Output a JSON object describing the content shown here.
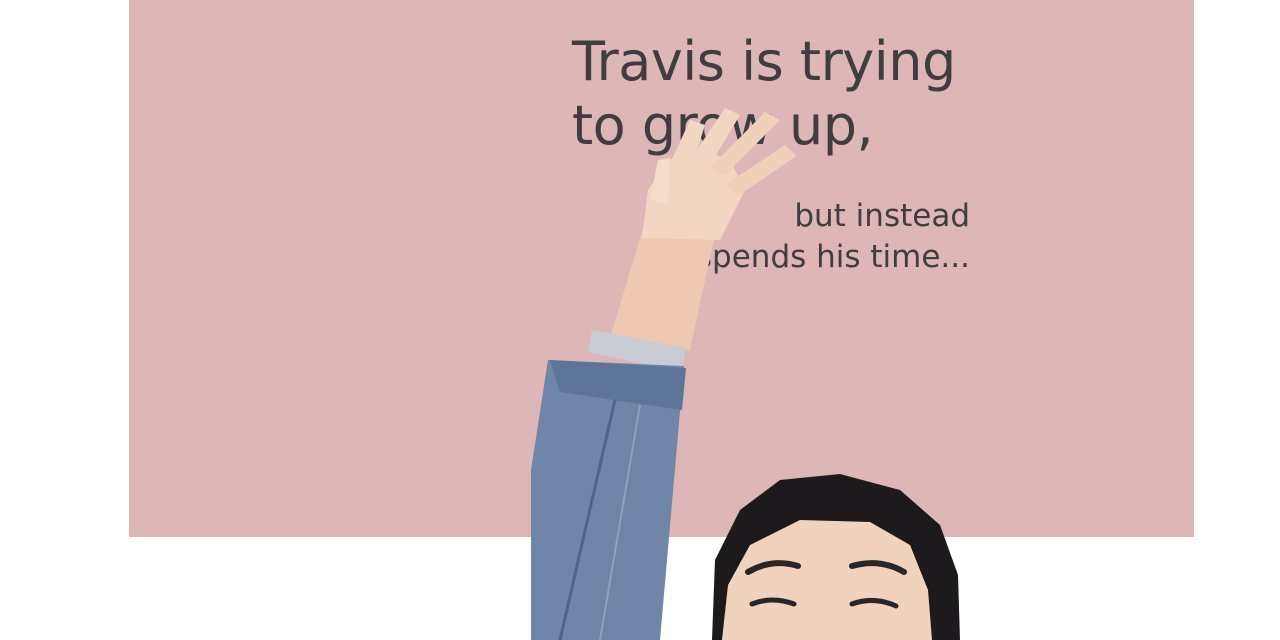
{
  "hero": {
    "headline_line1": "Travis is trying",
    "headline_line2": "to grow up,",
    "subline_line1": "but instead",
    "subline_line2": "spends his time..."
  },
  "colors": {
    "panel": "#deb6b8",
    "text": "#3f3d42",
    "denim": "#6f86a8",
    "skin": "#f1d2bd",
    "hair": "#1c1a1c"
  }
}
